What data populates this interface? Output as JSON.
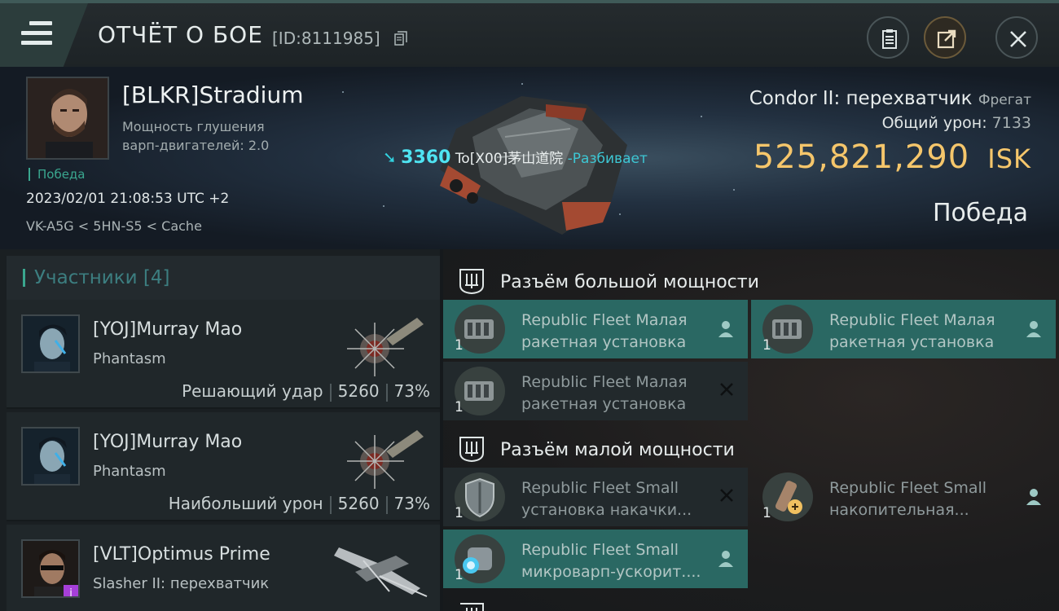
{
  "header": {
    "title": "ОТЧЁТ О БОЕ",
    "report_id": "[ID:8111985]"
  },
  "icons": {
    "menu": "menu-icon",
    "copy": "copy-icon",
    "clipboard": "clipboard-icon",
    "share": "share-icon",
    "close": "close-icon"
  },
  "victim": {
    "name": "[BLKR]Stradium",
    "attribute_line1": "Мощность глушения",
    "attribute_line2": "варп-двигателей: 2.0",
    "result_tag": "Победа",
    "datetime": "2023/02/01 21:08:53 UTC +2",
    "location": "VK-A5G < 5HN-S5 < Cache",
    "ship": "Condor II: перехватчик",
    "ship_class": "Фрегат",
    "total_damage_label": "Общий урон:",
    "total_damage": "7133",
    "value": "525,821,290",
    "value_unit": "ISK",
    "result": "Победа"
  },
  "killer": {
    "damage": "3360",
    "name": "To[X00]茅山道院",
    "action": "-Разбивает"
  },
  "participants": {
    "heading": "Участники [4]",
    "items": [
      {
        "name": "[YOJ]Murray Mao",
        "ship": "Phantasm",
        "role": "Решающий удар",
        "damage": "5260",
        "percent": "73%"
      },
      {
        "name": "[YOJ]Murray Mao",
        "ship": "Phantasm",
        "role": "Наибольший урон",
        "damage": "5260",
        "percent": "73%"
      },
      {
        "name": "[VLT]Optimus Prime",
        "ship": "Slasher II: перехватчик"
      }
    ]
  },
  "fittings": {
    "high_slots": {
      "title": "Разъём большой мощности",
      "modules": [
        {
          "line1": "Republic Fleet Малая",
          "line2": "ракетная установка",
          "qty": "1",
          "status": "online"
        },
        {
          "line1": "Republic Fleet Малая",
          "line2": "ракетная установка",
          "qty": "1",
          "status": "online"
        },
        {
          "line1": "Republic Fleet Малая",
          "line2": "ракетная установка",
          "qty": "1",
          "status": "destroyed"
        }
      ]
    },
    "low_slots": {
      "title": "Разъём малой мощности",
      "modules": [
        {
          "line1": "Republic Fleet Small",
          "line2": "установка накачки...",
          "qty": "1",
          "status": "destroyed"
        },
        {
          "line1": "Republic Fleet Small",
          "line2": "накопительная...",
          "qty": "1",
          "status": "online"
        },
        {
          "line1": "Republic Fleet Small",
          "line2": "микроварп-ускорит....",
          "qty": "1",
          "status": "online"
        }
      ]
    }
  },
  "colors": {
    "accent_teal": "#3aa78f",
    "killer_cyan": "#4fe4f2",
    "isk_gold": "#f5c66b",
    "module_online_bg": "#2a6863"
  }
}
